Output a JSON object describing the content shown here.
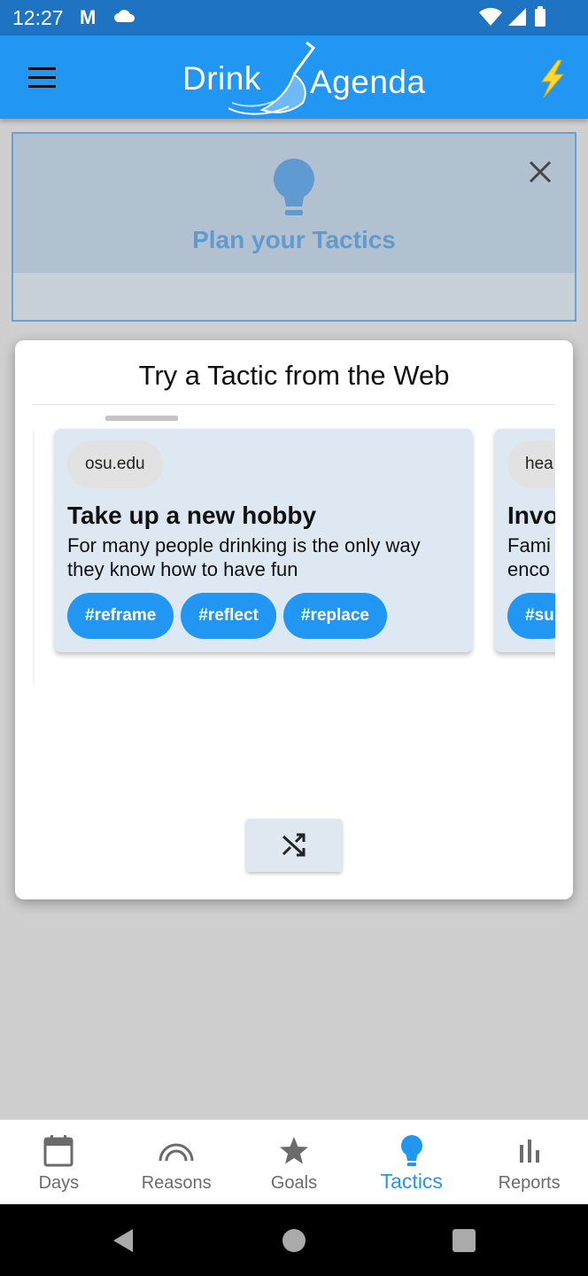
{
  "status_bar": {
    "time": "12:27",
    "mail_icon": "M"
  },
  "app_bar": {
    "logo_left": "Drink",
    "logo_right": "Agenda",
    "accent_color": "#2196f3",
    "bolt_color": "#fdd835"
  },
  "plan_card": {
    "title": "Plan your Tactics"
  },
  "dialog": {
    "title": "Try a Tactic from the Web",
    "cards": [
      {
        "source": "osu.edu",
        "title": "Take up a new hobby",
        "body": "For many people drinking is the only way they know how to have fun",
        "tags": [
          "#reframe",
          "#reflect",
          "#replace"
        ]
      },
      {
        "source": "hea",
        "title": "Invo",
        "body": "Fami enco",
        "tags": [
          "#su"
        ]
      }
    ]
  },
  "bottom_nav": {
    "items": [
      {
        "label": "Days",
        "icon": "calendar-icon",
        "active": false
      },
      {
        "label": "Reasons",
        "icon": "rainbow-icon",
        "active": false
      },
      {
        "label": "Goals",
        "icon": "star-icon",
        "active": false
      },
      {
        "label": "Tactics",
        "icon": "lightbulb-icon",
        "active": true
      },
      {
        "label": "Reports",
        "icon": "bar-chart-icon",
        "active": false
      }
    ]
  }
}
